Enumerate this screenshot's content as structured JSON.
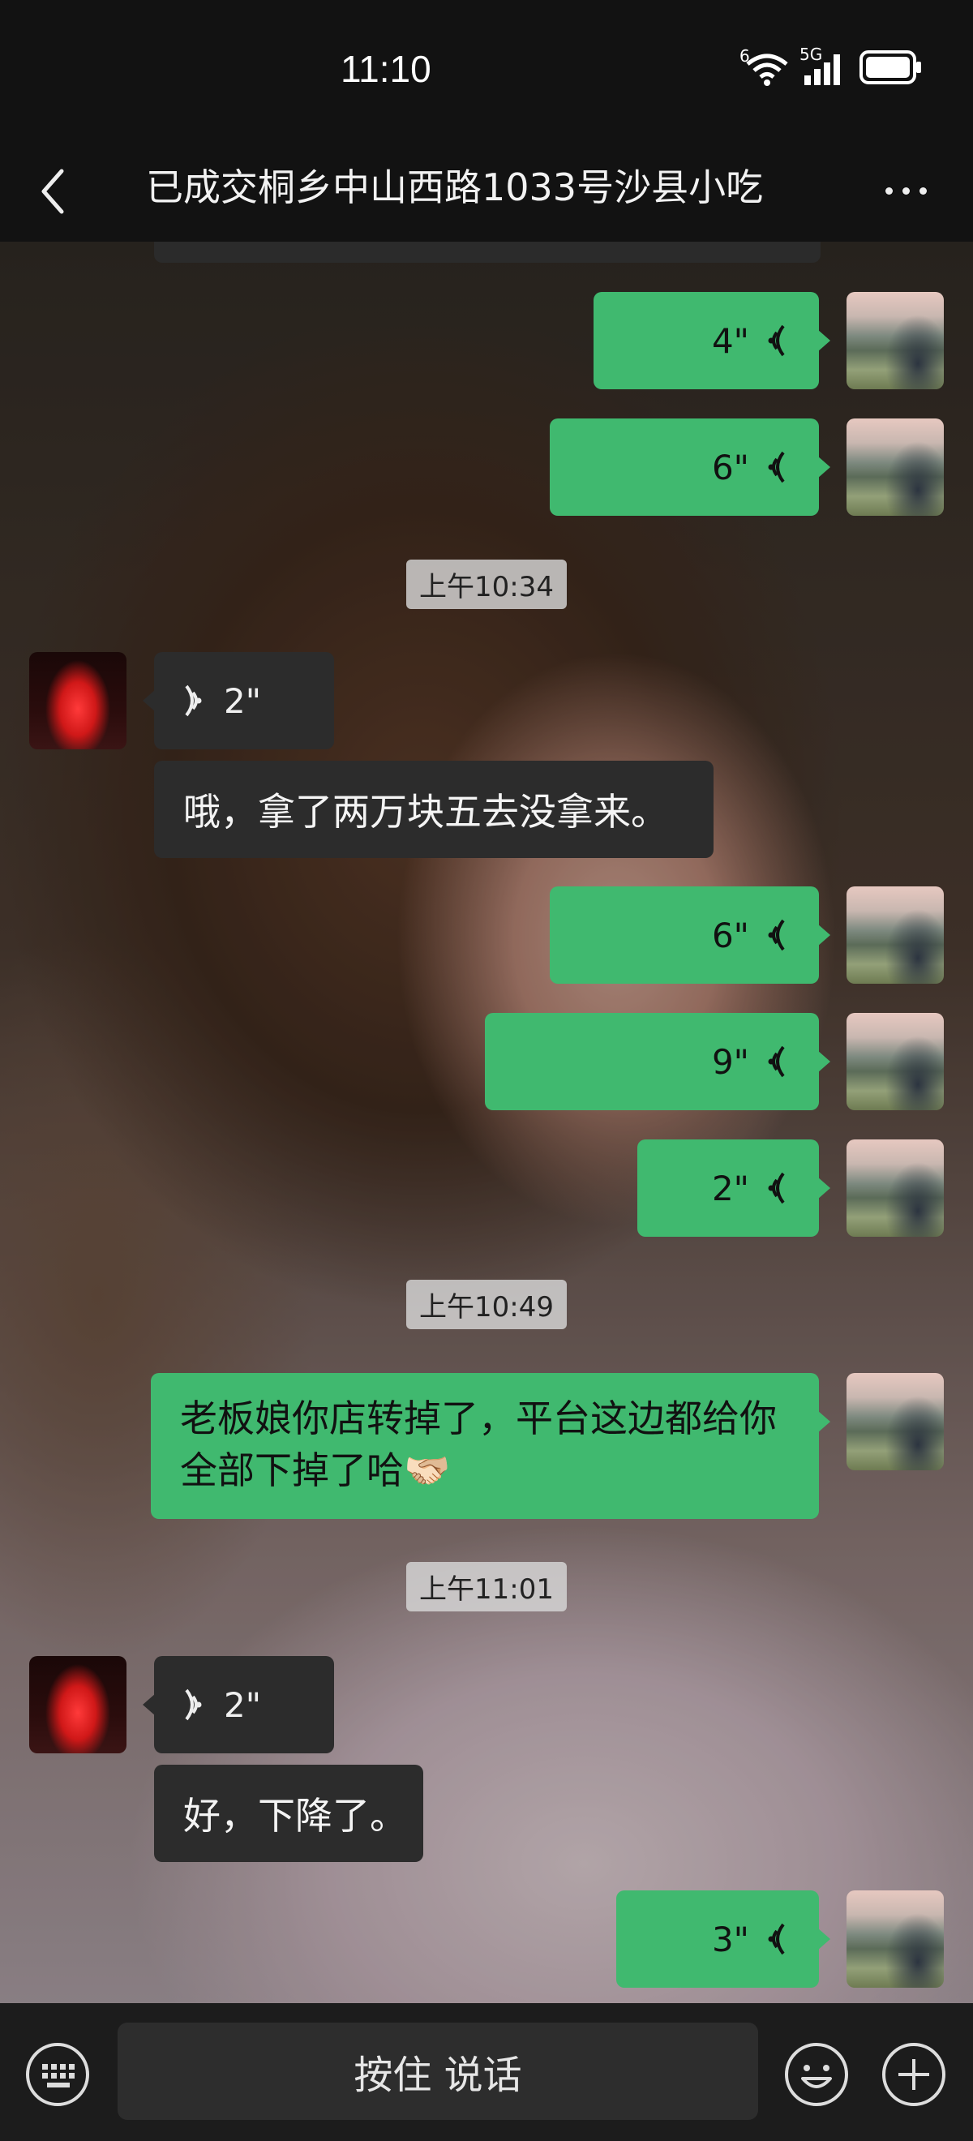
{
  "status_bar": {
    "time": "11:10",
    "wifi_label": "6",
    "signal_label": "5G"
  },
  "header": {
    "title": "已成交桐乡中山西路1033号沙县小吃"
  },
  "timestamps": [
    "上午10:34",
    "上午10:49",
    "上午11:01"
  ],
  "messages": {
    "m1": {
      "direction": "out",
      "type": "voice",
      "duration": "4\""
    },
    "m2": {
      "direction": "out",
      "type": "voice",
      "duration": "6\""
    },
    "m3": {
      "direction": "in",
      "type": "voice",
      "duration": "2\""
    },
    "m4": {
      "direction": "in",
      "type": "text",
      "text": "哦，拿了两万块五去没拿来。"
    },
    "m5": {
      "direction": "out",
      "type": "voice",
      "duration": "6\""
    },
    "m6": {
      "direction": "out",
      "type": "voice",
      "duration": "9\""
    },
    "m7": {
      "direction": "out",
      "type": "voice",
      "duration": "2\""
    },
    "m8": {
      "direction": "out",
      "type": "text",
      "text": "老板娘你店转掉了，平台这边都给你全部下掉了哈🫱🏻‍🫲🏼"
    },
    "m9": {
      "direction": "in",
      "type": "voice",
      "duration": "2\""
    },
    "m10": {
      "direction": "in",
      "type": "text",
      "text": "好，下降了。"
    },
    "m11": {
      "direction": "out",
      "type": "voice",
      "duration": "3\""
    }
  },
  "bottom_bar": {
    "talk_label": "按住 说话"
  },
  "colors": {
    "out_bubble": "#40b96f",
    "in_bubble": "#2c2c2c",
    "timestamp_bg": "#d7d7d7"
  },
  "icons": [
    "back-icon",
    "more-icon",
    "keyboard-icon",
    "emoji-icon",
    "plus-icon",
    "voice-icon"
  ]
}
